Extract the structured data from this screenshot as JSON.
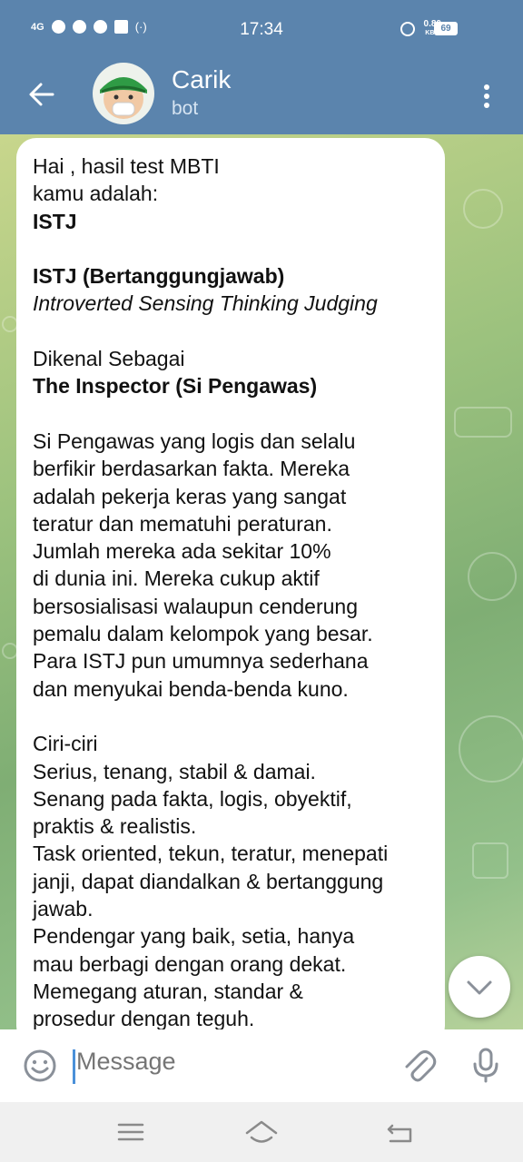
{
  "status_bar": {
    "network": "4G",
    "time": "17:34",
    "speed_value": "0.80",
    "speed_unit": "KB/s",
    "battery": "69"
  },
  "header": {
    "title": "Carik",
    "subtitle": "bot"
  },
  "message": {
    "greeting": "Hai , hasil test MBTI\nkamu adalah:",
    "type_code": "ISTJ",
    "type_heading": "ISTJ (Bertanggungjawab)",
    "type_expansion": "Introverted Sensing Thinking Judging",
    "known_as_label": "Dikenal Sebagai",
    "known_as_value": "The Inspector (Si Pengawas)",
    "description": "Si Pengawas yang logis dan selalu\nberfikir berdasarkan fakta. Mereka\nadalah pekerja keras yang sangat\nteratur dan mematuhi peraturan.\nJumlah mereka ada sekitar 10%\ndi dunia ini. Mereka cukup aktif\nbersosialisasi walaupun cenderung\npemalu dalam kelompok yang besar.\nPara ISTJ pun umumnya sederhana\ndan menyukai benda-benda kuno.",
    "traits_heading": "Ciri-ciri",
    "traits": [
      "Serius, tenang, stabil & damai.",
      "Senang pada fakta, logis, obyektif,\npraktis & realistis.",
      "Task oriented, tekun, teratur, menepati\njanji, dapat diandalkan & bertanggung\njawab.",
      "Pendengar yang baik, setia, hanya\nmau berbagi dengan orang dekat.",
      "Memegang aturan, standar &\nprosedur dengan teguh."
    ]
  },
  "input": {
    "placeholder": "Message"
  },
  "colors": {
    "header": "#5b84ad",
    "bubble": "#ffffff",
    "cursor": "#4a90d9"
  },
  "icons": [
    "back-arrow-icon",
    "more-vertical-icon",
    "chevron-down-icon",
    "emoji-icon",
    "attach-icon",
    "mic-icon",
    "nav-menu-icon",
    "nav-home-icon",
    "nav-back-icon"
  ]
}
